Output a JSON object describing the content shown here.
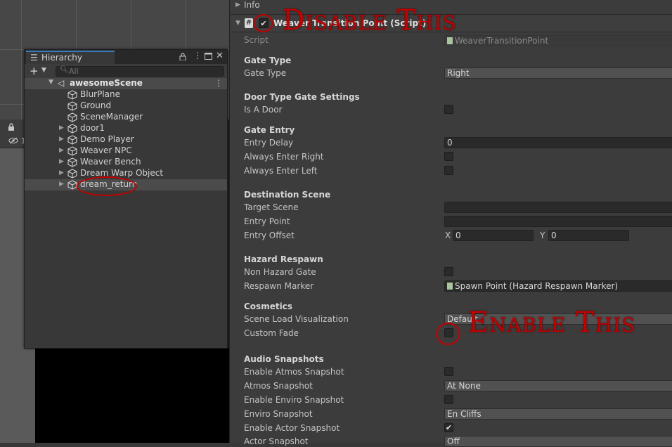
{
  "hierarchy": {
    "tab_label": "Hierarchy",
    "search_placeholder": "All",
    "scene_name": "awesomeScene",
    "items": [
      {
        "name": "BlurPlane",
        "expandable": false
      },
      {
        "name": "Ground",
        "expandable": false
      },
      {
        "name": "SceneManager",
        "expandable": false
      },
      {
        "name": "door1",
        "expandable": true
      },
      {
        "name": "Demo Player",
        "expandable": true
      },
      {
        "name": "Weaver NPC",
        "expandable": true
      },
      {
        "name": "Weaver Bench",
        "expandable": true
      },
      {
        "name": "Dream Warp Object",
        "expandable": true
      },
      {
        "name": "dream_return",
        "expandable": true
      }
    ]
  },
  "scene_toolbar": {
    "eye_count": "1"
  },
  "inspector": {
    "info_label": "Info",
    "component_title": "Weaver Transition Point (Script)",
    "script_label": "Script",
    "script_value": "WeaverTransitionPoint",
    "gate_type_header": "Gate Type",
    "gate_type_label": "Gate Type",
    "gate_type_value": "Right",
    "door_header": "Door Type Gate Settings",
    "is_a_door_label": "Is A Door",
    "gate_entry_header": "Gate Entry",
    "entry_delay_label": "Entry Delay",
    "entry_delay_value": "0",
    "always_right_label": "Always Enter Right",
    "always_left_label": "Always Enter Left",
    "destination_header": "Destination Scene",
    "target_scene_label": "Target Scene",
    "entry_point_label": "Entry Point",
    "entry_offset_label": "Entry Offset",
    "entry_offset_x_label": "X",
    "entry_offset_x": "0",
    "entry_offset_y_label": "Y",
    "entry_offset_y": "0",
    "hazard_header": "Hazard Respawn",
    "non_hazard_label": "Non Hazard Gate",
    "respawn_marker_label": "Respawn Marker",
    "respawn_marker_value": "Spawn Point (Hazard Respawn Marker)",
    "cosmetics_header": "Cosmetics",
    "scene_load_label": "Scene Load Visualization",
    "scene_load_value": "Default",
    "custom_fade_label": "Custom Fade",
    "audio_header": "Audio Snapshots",
    "enable_atmos_label": "Enable Atmos Snapshot",
    "atmos_label": "Atmos Snapshot",
    "atmos_value": "At None",
    "enable_enviro_label": "Enable Enviro Snapshot",
    "enviro_label": "Enviro Snapshot",
    "enviro_value": "En Cliffs",
    "enable_actor_label": "Enable Actor Snapshot",
    "actor_label": "Actor Snapshot",
    "actor_value": "Off"
  },
  "annotations": {
    "disable_text": "Disable This",
    "enable_text": "Enable This"
  },
  "colors": {
    "annotation": "#c40000",
    "tab_accent": "#3a79bb"
  }
}
